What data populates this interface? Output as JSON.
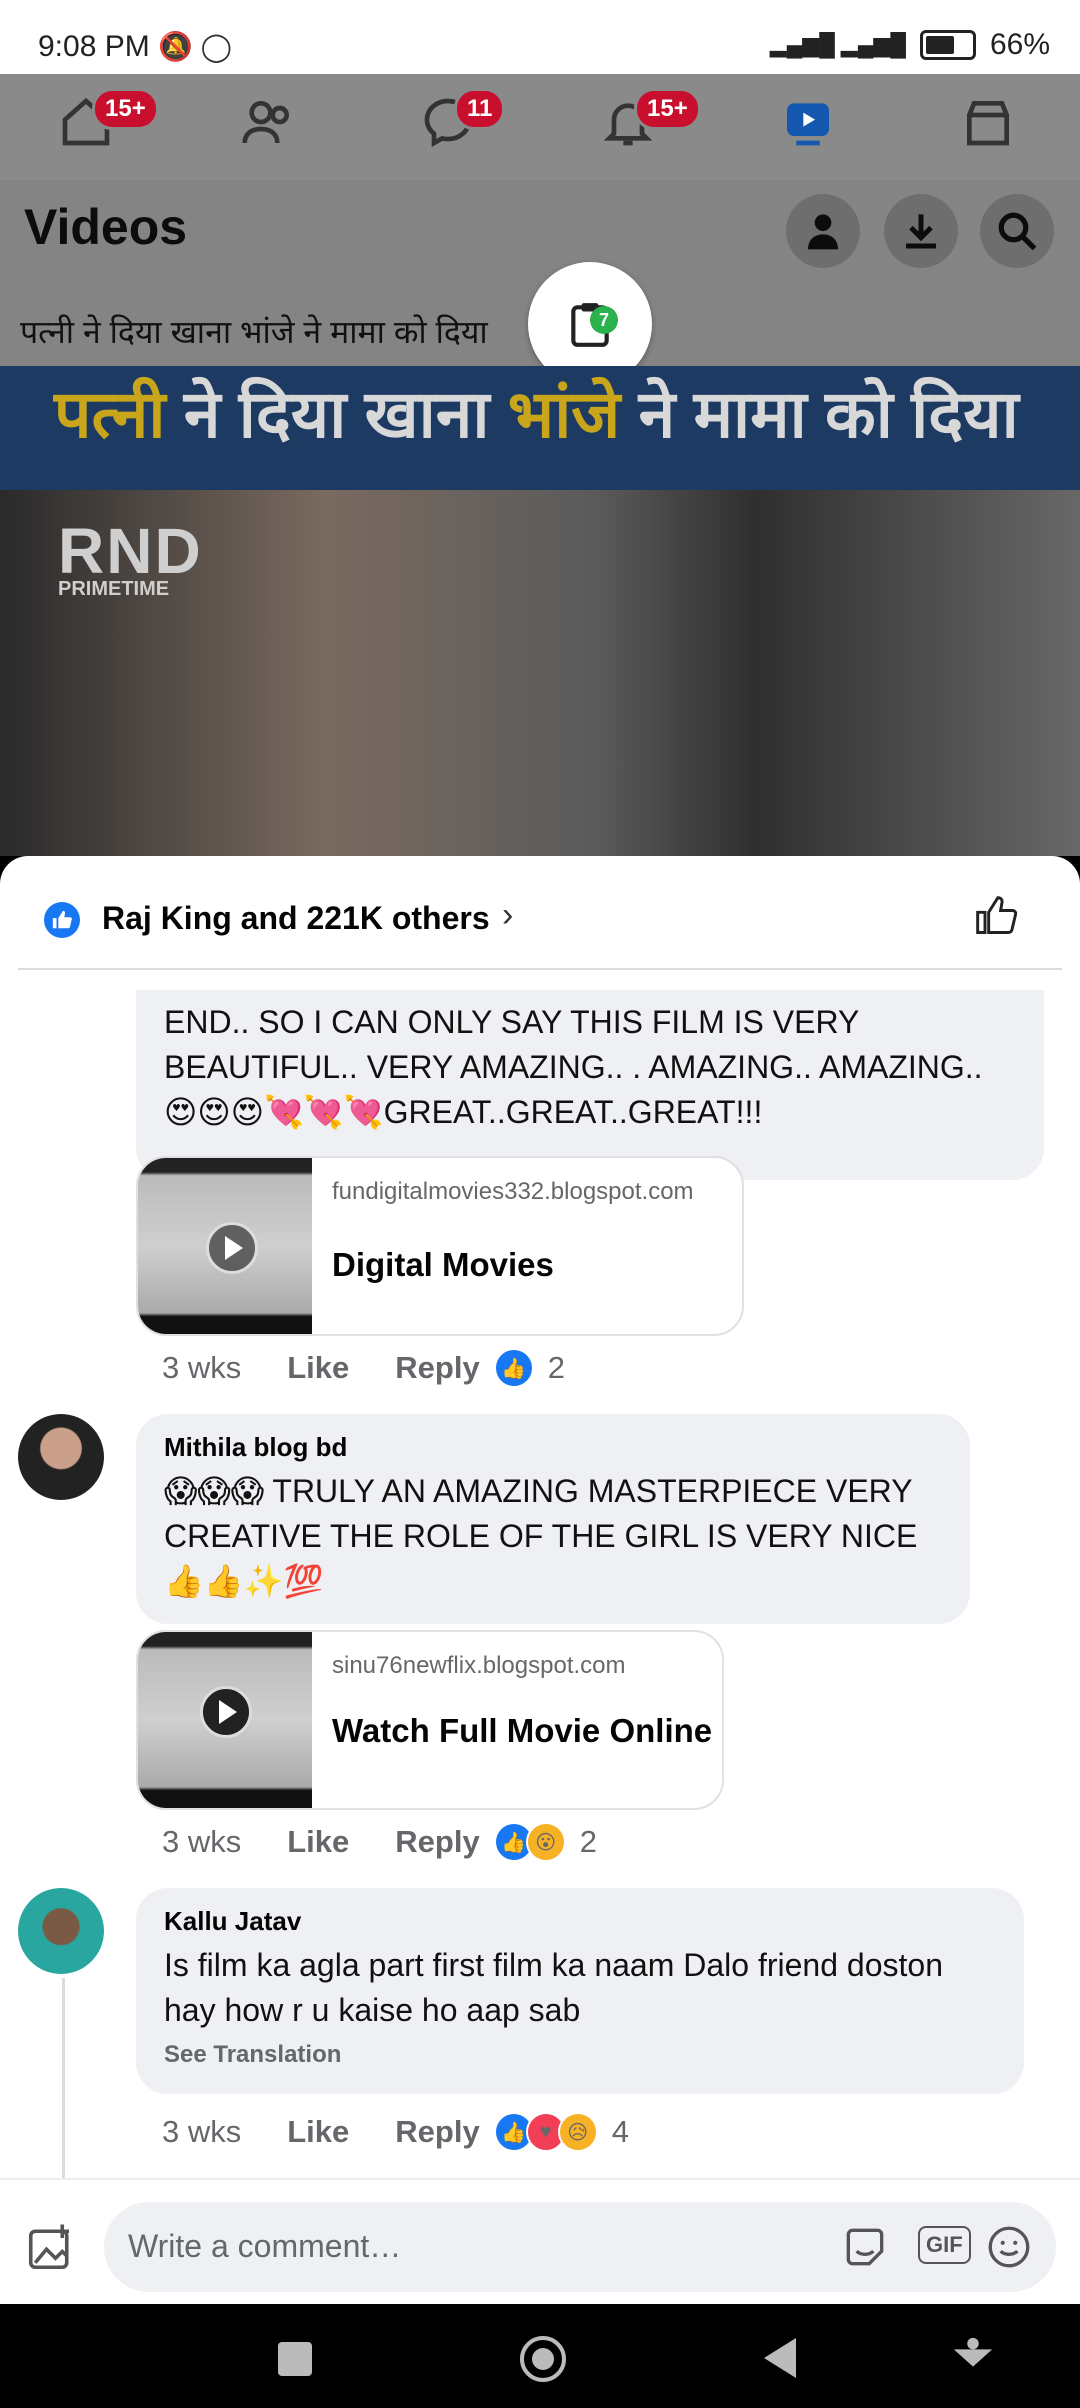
{
  "status_bar": {
    "time": "9:08 PM",
    "battery": "66%"
  },
  "nav": {
    "badges": {
      "home": "15+",
      "messenger": "11",
      "notifications": "15+"
    }
  },
  "header": {
    "title": "Videos"
  },
  "video": {
    "title": "पत्नी ने दिया खाना भांजे ने मामा को दिया",
    "banner_part1": "पत्नी",
    "banner_part2": " ने दिया खाना ",
    "banner_part3": "भांजे",
    "banner_part4": " ने मामा को दिया",
    "watermark": "RND",
    "watermark_sub": "PRIMETIME",
    "clipboard_count": "7"
  },
  "reactions_bar": {
    "text": "Raj King and 221K others"
  },
  "comments": [
    {
      "text": "END.. SO I CAN ONLY SAY THIS FILM IS VERY BEAUTIFUL.. VERY AMAZING.. . AMAZING.. AMAZING.. 😍😍😍💘💘💘GREAT..GREAT..GREAT!!!",
      "link_domain": "fundigitalmovies332.blogspot.com",
      "link_title": "Digital Movies",
      "time": "3 wks",
      "like": "Like",
      "reply": "Reply",
      "count": "2"
    },
    {
      "author": "Mithila blog bd",
      "text": "😱😱😱 TRULY AN AMAZING MASTERPIECE VERY CREATIVE THE ROLE OF THE GIRL IS VERY NICE👍👍✨💯",
      "link_domain": "sinu76newflix.blogspot.com",
      "link_title": "Watch Full Movie Online",
      "time": "3 wks",
      "like": "Like",
      "reply": "Reply",
      "count": "2"
    },
    {
      "author": "Kallu Jatav",
      "text": "Is film ka agla part first film ka naam Dalo friend doston hay how r u kaise ho aap sab",
      "see_translation": "See Translation",
      "time": "3 wks",
      "like": "Like",
      "reply": "Reply",
      "count": "4"
    }
  ],
  "composer": {
    "placeholder": "Write a comment…",
    "gif": "GIF"
  },
  "colors": {
    "accent": "#1877f2",
    "badge": "#c8102e",
    "bubble": "#eef0f3"
  }
}
